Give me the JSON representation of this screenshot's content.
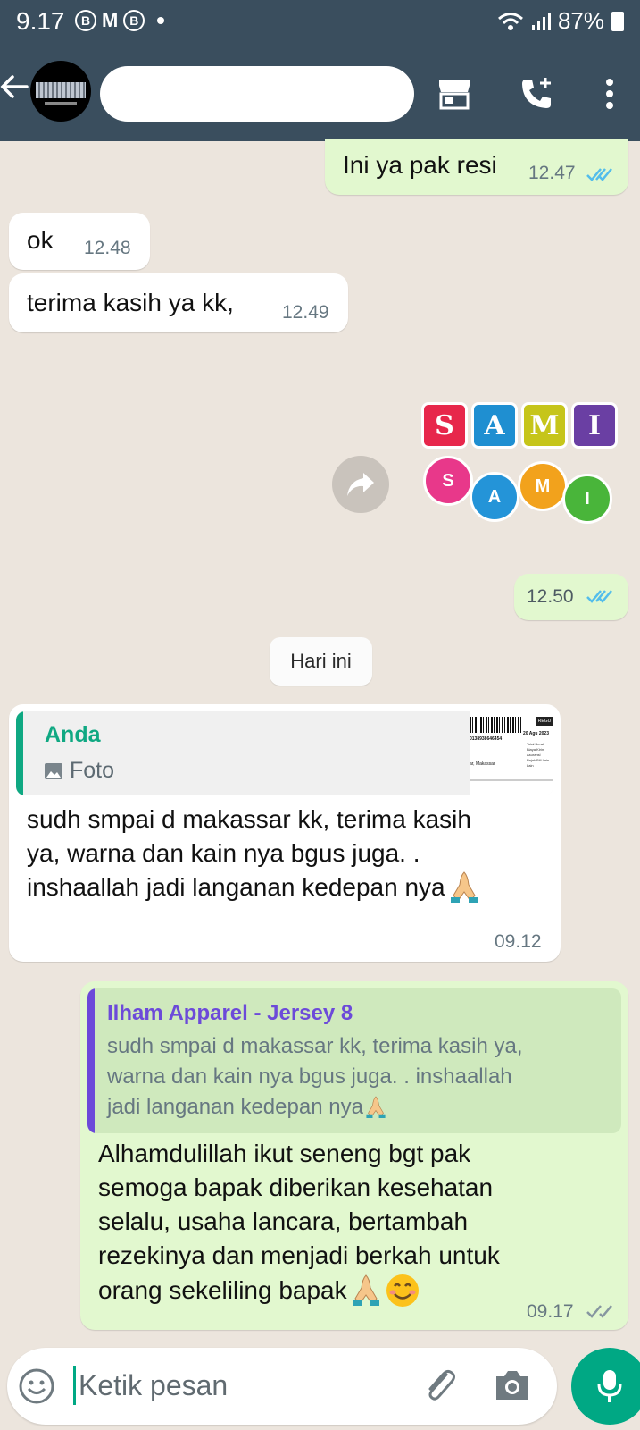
{
  "status": {
    "time": "9.17",
    "battery": "87%"
  },
  "header": {
    "contact_name": ""
  },
  "messages": {
    "m1": {
      "text": "Ini ya pak resi",
      "time": "12.47"
    },
    "m2": {
      "text": "ok",
      "time": "12.48"
    },
    "m3": {
      "text": "terima kasih ya kk,",
      "time": "12.49"
    },
    "m4": {
      "time": "12.50",
      "sticker_letters": [
        "S",
        "A",
        "M",
        "I"
      ],
      "sticker_balls": [
        "S",
        "A",
        "M",
        "I"
      ]
    },
    "date_divider": "Hari ini",
    "m5": {
      "quote_author": "Anda",
      "quote_type": "Foto",
      "text_line1": "sudh smpai d makassar kk, terima kasih",
      "text_line2": "ya, warna dan kain nya bgus juga. .",
      "text_line3": "inshaallah jadi langanan kedepan nya",
      "time": "09.12",
      "thumb": {
        "label": "REGU",
        "date": "20 Agu 2023",
        "code": "0138938646454",
        "city": "ar, Makassar",
        "side": "Total Berat Biaya Kirim Asuransi Pajak/Bill Lain-Lain"
      }
    },
    "m6": {
      "quote_author": "Ilham Apparel - Jersey 8",
      "quote_line1": "sudh smpai d makassar kk, terima kasih ya,",
      "quote_line2": "warna dan kain nya bgus juga. . inshaallah",
      "quote_line3": "jadi langanan kedepan nya",
      "line1": "Alhamdulillah ikut seneng bgt pak",
      "line2": "semoga bapak diberikan kesehatan",
      "line3": "selalu, usaha lancara, bertambah",
      "line4": "rezekinya dan menjadi berkah untuk",
      "line5": "orang sekeliling bapak",
      "time": "09.17"
    }
  },
  "composer": {
    "placeholder": "Ketik pesan"
  },
  "colors": {
    "header": "#3a4e5e",
    "outgoing": "#e2f8cf",
    "incoming": "#ffffff",
    "accent": "#00a884",
    "tick_blue": "#53bdeb"
  }
}
